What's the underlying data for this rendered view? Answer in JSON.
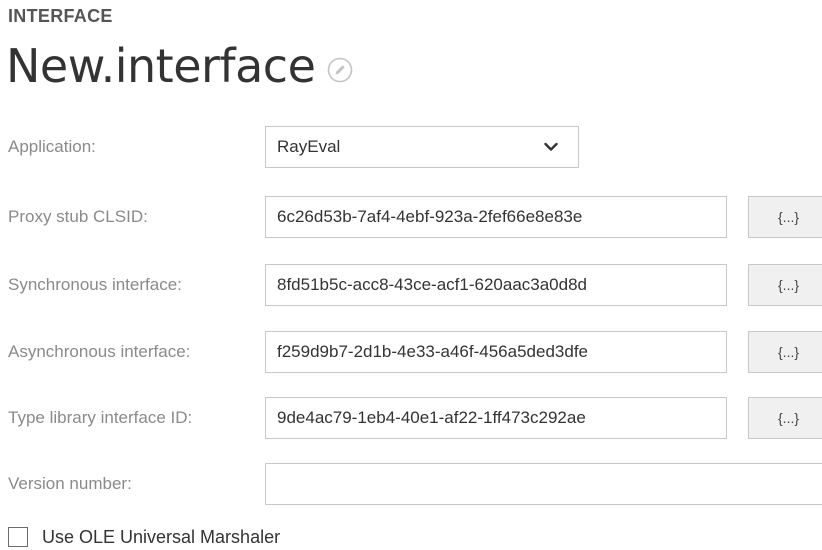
{
  "header": {
    "section_label": "INTERFACE",
    "title": "New.interface",
    "edit_icon": "pencil-in-circle-icon"
  },
  "form": {
    "application": {
      "label": "Application:",
      "value": "RayEval",
      "chevron_icon": "chevron-down-icon"
    },
    "proxy_stub_clsid": {
      "label": "Proxy stub CLSID:",
      "value": "6c26d53b-7af4-4ebf-923a-2fef66e8e83e",
      "button_label": "{...}"
    },
    "synchronous_interface": {
      "label": "Synchronous interface:",
      "value": "8fd51b5c-acc8-43ce-acf1-620aac3a0d8d",
      "button_label": "{...}"
    },
    "asynchronous_interface": {
      "label": "Asynchronous interface:",
      "value": "f259d9b7-2d1b-4e33-a46f-456a5ded3dfe",
      "button_label": "{...}"
    },
    "type_library_interface_id": {
      "label": "Type library interface ID:",
      "value": "9de4ac79-1eb4-40e1-af22-1ff473c292ae",
      "button_label": "{...}"
    },
    "version_number": {
      "label": "Version number:",
      "value": ""
    },
    "use_ole_universal_marshaler": {
      "label": "Use OLE Universal Marshaler",
      "checked": false
    }
  },
  "colors": {
    "label_gray": "#8a8a8a",
    "text": "#333333",
    "border": "#c8c8c8",
    "button_bg": "#f0f0f0"
  }
}
